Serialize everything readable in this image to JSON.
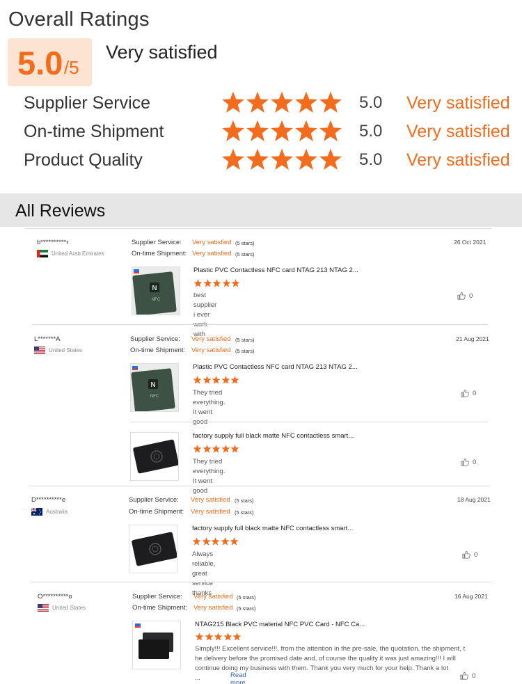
{
  "overall": {
    "title": "Overall Ratings",
    "score": "5.0",
    "score_max": "/5",
    "verdict": "Very satisfied",
    "accent_color": "#f36b1c",
    "rows": [
      {
        "label": "Supplier Service",
        "value": "5.0",
        "verdict": "Very satisfied",
        "stars": 5
      },
      {
        "label": "On-time Shipment",
        "value": "5.0",
        "verdict": "Very satisfied",
        "stars": 5
      },
      {
        "label": "Product Quality",
        "value": "5.0",
        "verdict": "Very satisfied",
        "stars": 5
      }
    ]
  },
  "reviews_header": "All Reviews",
  "reviews": [
    {
      "name": "b**********r",
      "country": "United Arab Emirates",
      "flag": "uae-flag",
      "date": "26 Oct 2021",
      "supplier_label": "Supplier Service:",
      "supplier_value": "Very satisfied",
      "supplier_stars": "(5 stars)",
      "shipment_label": "On-time Shipment:",
      "shipment_value": "Very satisfied",
      "shipment_stars": "(5 stars)",
      "products": [
        {
          "name": "Plastic PVC Contactless NFC card NTAG 213 NTAG 2...",
          "comment": "best supplier i ever work with",
          "likes": "0",
          "stars": 5,
          "thumb": "nfc-card-green"
        }
      ]
    },
    {
      "name": "L*******A",
      "country": "United States",
      "flag": "us-flag",
      "date": "21 Aug 2021",
      "supplier_label": "Supplier Service:",
      "supplier_value": "Very satisfied",
      "supplier_stars": "(5 stars)",
      "shipment_label": "On-time Shipment:",
      "shipment_value": "Very satisfied",
      "shipment_stars": "(5 stars)",
      "products": [
        {
          "name": "Plastic PVC Contactless NFC card NTAG 213 NTAG 2...",
          "comment": "They tried everything. It went good",
          "likes": "0",
          "stars": 5,
          "thumb": "nfc-card-green"
        },
        {
          "name": "factory supply full black matte NFC contactless smart...",
          "comment": "They tried everything. It went good",
          "likes": "0",
          "stars": 5,
          "thumb": "nfc-card-black"
        }
      ]
    },
    {
      "name": "D**********e",
      "country": "Australia",
      "flag": "au-flag",
      "date": "18 Aug 2021",
      "supplier_label": "Supplier Service:",
      "supplier_value": "Very satisfied",
      "supplier_stars": "(5 stars)",
      "shipment_label": "On-time Shipment:",
      "shipment_value": "Very satisfied",
      "shipment_stars": "(5 stars)",
      "products": [
        {
          "name": "factory supply full black matte NFC contactless smart...",
          "comment": "Always reliable, great service thanks",
          "likes": "0",
          "stars": 5,
          "thumb": "nfc-card-black"
        }
      ]
    },
    {
      "name": "O**********o",
      "country": "United States",
      "flag": "us-flag",
      "date": "16 Aug 2021",
      "supplier_label": "Supplier Service:",
      "supplier_value": "Very satisfied",
      "supplier_stars": "(5 stars)",
      "shipment_label": "On-time Shipment:",
      "shipment_value": "Very satisfied",
      "shipment_stars": "(5 stars)",
      "products": [
        {
          "name": "NTAG215 Black PVC material NFC PVC Card - NFC Ca...",
          "comment_lines": [
            "Simply!!! Excellent service!!!, from the attention in the pre-sale, the quotation, the shipment, t",
            "he delivery before the promised date and, of course the quality it was just amazing!!!  I will",
            "continue doing my business with them.  Thank you very much for your help. Thank a lot",
            "..."
          ],
          "read_more": "Read more",
          "likes": "0",
          "stars": 5,
          "thumb": "nfc-cards-pair"
        }
      ]
    }
  ]
}
